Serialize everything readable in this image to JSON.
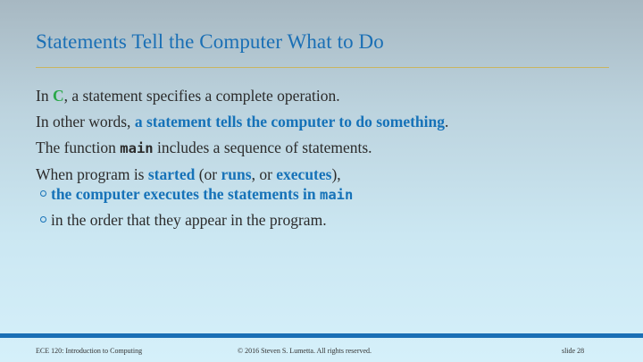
{
  "slide": {
    "title": "Statements Tell the Computer What to Do",
    "p1": {
      "pre": "In ",
      "c": "C",
      "post": ", a statement specifies a complete operation."
    },
    "p2": {
      "pre": "In other words, ",
      "bold": "a statement tells the computer to do something",
      "post": "."
    },
    "p3": {
      "pre": "The function ",
      "code": "main",
      "post": " includes a sequence of statements."
    },
    "p4": {
      "t1": "When program is ",
      "k1": "started",
      "t2": " (or ",
      "k2": "runs",
      "t3": ", or ",
      "k3": "executes",
      "t4": "),"
    },
    "bullets": {
      "b1_bold": "the computer executes the statements in ",
      "b1_code": "main",
      "b2": "in the order that they appear in the program."
    }
  },
  "footer": {
    "course": "ECE 120: Introduction to Computing",
    "copyright": "© 2016 Steven S. Lumetta.  All rights reserved.",
    "slide_number": "slide 28"
  },
  "colors": {
    "title": "#1a6fb5",
    "keyword": "#1672b8",
    "c_letter": "#2aa84a",
    "rule": "#c9b560",
    "footer_bar": "#1a6fb5"
  }
}
